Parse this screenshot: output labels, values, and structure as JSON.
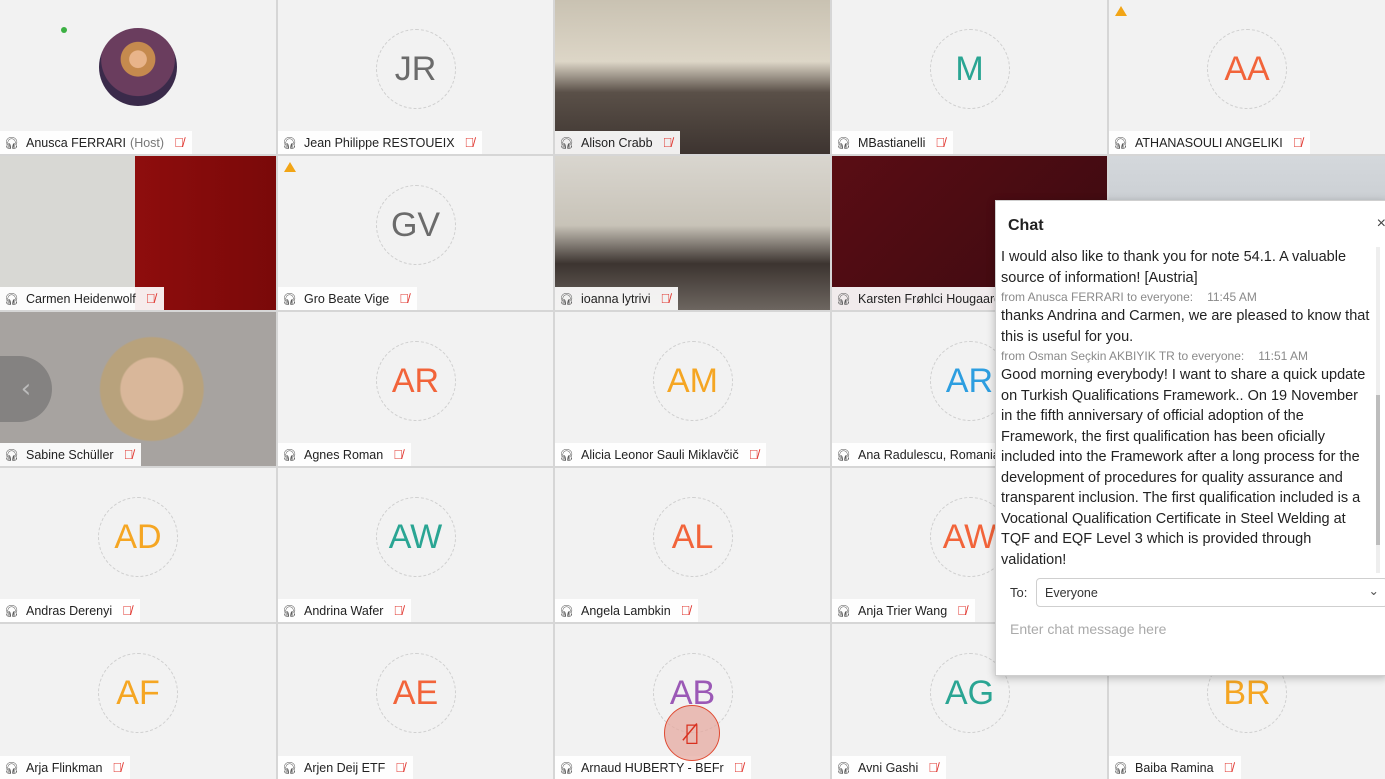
{
  "colors": {
    "active_speaker": "#1ec3f0",
    "mute": "#e0322b",
    "warning": "#f2a516"
  },
  "participants": [
    {
      "name": "Anusca FERRARI",
      "suffix": "(Host)",
      "type": "photo",
      "status_dot": true
    },
    {
      "name": "Jean Philippe RESTOUEIX",
      "initials": "JR",
      "color": "#6b6b6b"
    },
    {
      "name": "Alison Crabb",
      "type": "video",
      "bg": "linear-gradient(180deg,#c9c2b2 0%,#ddd6c7 40%,#5a5048 60%,#3d3430 100%)"
    },
    {
      "name": "MBastianelli",
      "initials": "M",
      "color": "#2aa593"
    },
    {
      "name": "ATHANASOULI ANGELIKI",
      "initials": "AA",
      "color": "#f2643a",
      "warning": true
    },
    {
      "name": "Carmen Heidenwolf",
      "type": "video",
      "bg": "linear-gradient(90deg,#d8d8d4 0%,#d8d8d4 49%,#8e0d0d 49%,#7a0909 100%)"
    },
    {
      "name": "Gro Beate Vige",
      "initials": "GV",
      "color": "#6b6b6b",
      "warning": true
    },
    {
      "name": "ioanna lytrivi",
      "type": "video",
      "bg": "linear-gradient(180deg,#d9d6cf 0%,#c8c3b8 45%,#3c3430 70%,#6d6660 100%)"
    },
    {
      "name": "Karsten Frøhlci Hougaard",
      "type": "video",
      "bg": "linear-gradient(135deg,#5a0d14 0%,#3a0a10 100%)"
    },
    {
      "name": "",
      "type": "video",
      "bg": "linear-gradient(180deg,#d4d8dc,#b8bcc0)"
    },
    {
      "name": "Sabine Schüller",
      "type": "video",
      "active": true,
      "bg": "radial-gradient(circle at 55% 50%,#d9b79a 0 18%,#b8a27c 19% 30%,#a7a3a0 31%)"
    },
    {
      "name": "Agnes Roman",
      "initials": "AR",
      "color": "#f2643a"
    },
    {
      "name": "Alicia Leonor Sauli Miklavčič",
      "initials": "AM",
      "color": "#f5a623"
    },
    {
      "name": "Ana Radulescu, Romania",
      "initials": "AR",
      "color": "#2d9ee0"
    },
    {
      "name": "",
      "initials": "",
      "color": "#999"
    },
    {
      "name": "Andras Derenyi",
      "initials": "AD",
      "color": "#f5a623"
    },
    {
      "name": "Andrina Wafer",
      "initials": "AW",
      "color": "#2aa593"
    },
    {
      "name": "Angela Lambkin",
      "initials": "AL",
      "color": "#f2643a"
    },
    {
      "name": "Anja Trier Wang",
      "initials": "AW",
      "color": "#f2643a"
    },
    {
      "name": "",
      "initials": "",
      "color": "#999"
    },
    {
      "name": "Arja Flinkman",
      "initials": "AF",
      "color": "#f5a623"
    },
    {
      "name": "Arjen Deij ETF",
      "initials": "AE",
      "color": "#f2643a"
    },
    {
      "name": "Arnaud HUBERTY - BEFr",
      "initials": "AB",
      "color": "#9b59b6"
    },
    {
      "name": "Avni Gashi",
      "initials": "AG",
      "color": "#2aa593"
    },
    {
      "name": "Baiba Ramina",
      "initials": "BR",
      "color": "#f5a623"
    }
  ],
  "chat": {
    "title": "Chat",
    "close": "×",
    "messages": [
      {
        "text": "I would also like to thank you for note 54.1. A valuable source of information! [Austria]"
      },
      {
        "from": "from Anusca FERRARI to everyone:",
        "time": "11:45 AM",
        "text": "thanks Andrina and Carmen, we are pleased to know that this is useful for you."
      },
      {
        "from": "from Osman Seçkin AKBIYIK TR to everyone:",
        "time": "11:51 AM",
        "text": "Good morning everybody! I want to share a quick update on Turkish Qualifications Framework.. On 19 November in the fifth anniversary of official adoption of the Framework, the first qualification has been oficially included into the Framework after a long process for the development of procedures for quality assurance and transparent inclusion. The first qualification included is a Vocational Qualification Certificate in Steel Welding at TQF and EQF Level 3 which is provided through validation!"
      }
    ],
    "to_label": "To:",
    "recipient": "Everyone",
    "input_placeholder": "Enter chat message here"
  }
}
